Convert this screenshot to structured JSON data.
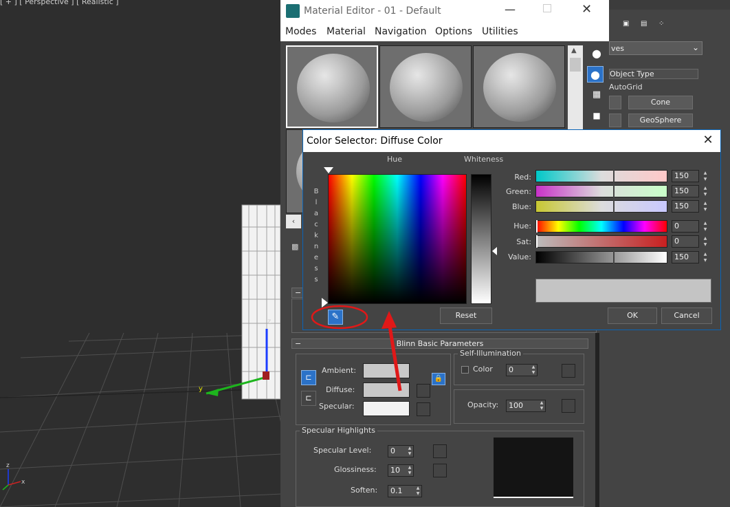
{
  "viewport": {
    "label": "[ + ] [ Perspective ] [ Realistic ]",
    "axis_z": "z",
    "axis_y": "y",
    "axis_x": "x"
  },
  "command_panel": {
    "dropdown_value": "ves",
    "rollout_title": "Object Type",
    "autogrid_label": "AutoGrid",
    "buttons": [
      "Cone",
      "GeoSphere"
    ]
  },
  "material_editor": {
    "title": "Material Editor - 01 - Default",
    "menus": [
      "Modes",
      "Material",
      "Navigation",
      "Options",
      "Utilities"
    ],
    "blinn_rollout": "Blinn Basic Parameters",
    "self_illum_title": "Self-Illumination",
    "color_checkbox_label": "Color",
    "color_value": "0",
    "opacity_label": "Opacity:",
    "opacity_value": "100",
    "ambient_label": "Ambient:",
    "diffuse_label": "Diffuse:",
    "specular_label": "Specular:",
    "specular_highlights_title": "Specular Highlights",
    "specular_level_label": "Specular Level:",
    "specular_level_value": "0",
    "glossiness_label": "Glossiness:",
    "glossiness_value": "10",
    "soften_label": "Soften:",
    "soften_value": "0.1",
    "colors": {
      "ambient": "#c8c8c8",
      "diffuse": "#c8c8c8",
      "specular": "#f2f2f2"
    }
  },
  "color_selector": {
    "title": "Color Selector: Diffuse Color",
    "hue_label": "Hue",
    "whiteness_label": "Whiteness",
    "blackness_letters": [
      "B",
      "l",
      "a",
      "c",
      "k",
      "n",
      "e",
      "s",
      "s"
    ],
    "sliders": [
      {
        "label": "Red:",
        "value": "150"
      },
      {
        "label": "Green:",
        "value": "150"
      },
      {
        "label": "Blue:",
        "value": "150"
      },
      {
        "label": "Hue:",
        "value": "0"
      },
      {
        "label": "Sat:",
        "value": "0"
      },
      {
        "label": "Value:",
        "value": "150"
      }
    ],
    "reset_label": "Reset",
    "ok_label": "OK",
    "cancel_label": "Cancel",
    "current_color": "#969696"
  }
}
